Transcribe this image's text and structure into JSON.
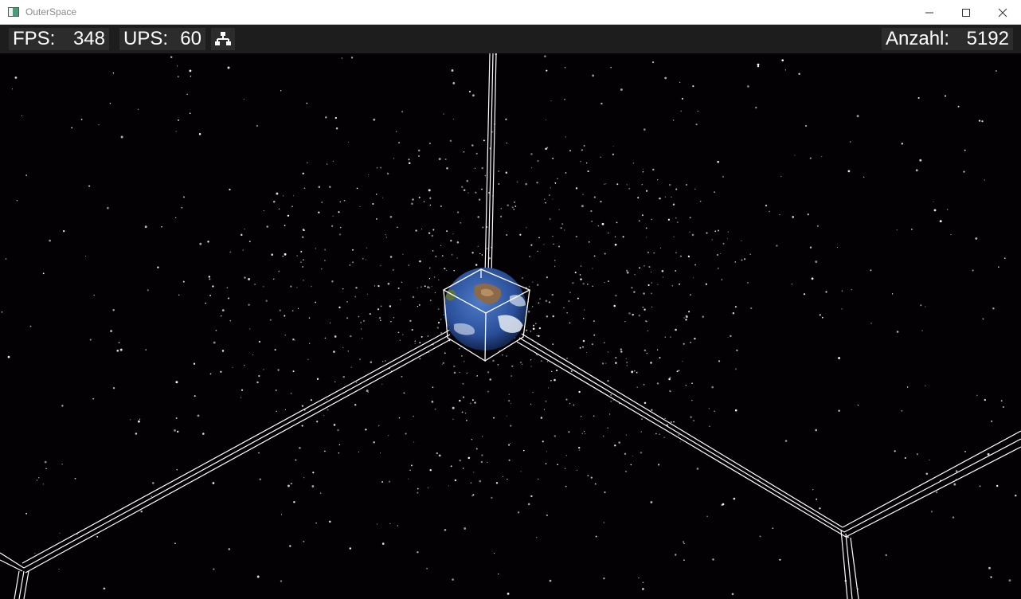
{
  "window": {
    "title": "OuterSpace",
    "controls": {
      "minimize": "—",
      "maximize": "☐",
      "close": "✕"
    }
  },
  "hud": {
    "fps_label": "FPS:",
    "fps_value": "348",
    "ups_label": "UPS:",
    "ups_value": "60",
    "hierarchy_icon": "hierarchy-icon",
    "count_label": "Anzahl:",
    "count_value": "5192"
  },
  "scene": {
    "background_color": "#030104",
    "line_color": "#ffffff",
    "planet": "earth"
  }
}
